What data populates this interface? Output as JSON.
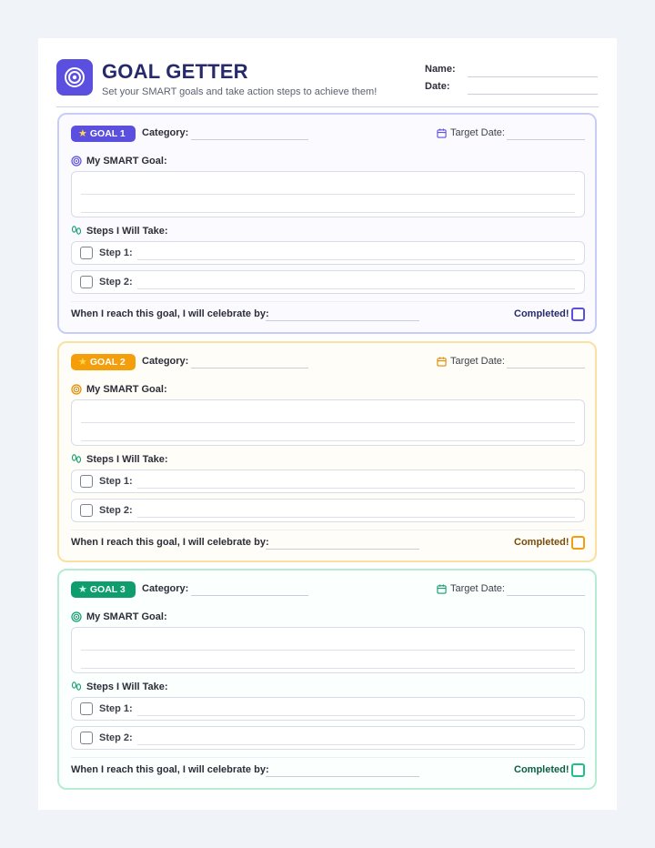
{
  "header": {
    "title": "GOAL GETTER",
    "subtitle": "Set your SMART goals and take action steps to achieve them!",
    "name_label": "Name:",
    "date_label": "Date:",
    "logo_icon": "target-icon"
  },
  "colors": {
    "goal1_accent": "#5b4fe0",
    "goal2_accent": "#f59e0b",
    "goal3_accent": "#0f9d6e"
  },
  "goals": [
    {
      "badge": "GOAL 1",
      "category_label": "Category:",
      "target_date_label": "Target Date:",
      "smart_goal_label": "My SMART Goal:",
      "steps_label": "Steps I Will Take:",
      "steps": [
        "Step 1:",
        "Step 2:"
      ],
      "celebrate_label": "When I reach this goal, I will celebrate by:",
      "completed_label": "Completed!"
    },
    {
      "badge": "GOAL 2",
      "category_label": "Category:",
      "target_date_label": "Target Date:",
      "smart_goal_label": "My SMART Goal:",
      "steps_label": "Steps I Will Take:",
      "steps": [
        "Step 1:",
        "Step 2:"
      ],
      "celebrate_label": "When I reach this goal, I will celebrate by:",
      "completed_label": "Completed!"
    },
    {
      "badge": "GOAL 3",
      "category_label": "Category:",
      "target_date_label": "Target Date:",
      "smart_goal_label": "My SMART Goal:",
      "steps_label": "Steps I Will Take:",
      "steps": [
        "Step 1:",
        "Step 2:"
      ],
      "celebrate_label": "When I reach this goal, I will celebrate by:",
      "completed_label": "Completed!"
    }
  ]
}
